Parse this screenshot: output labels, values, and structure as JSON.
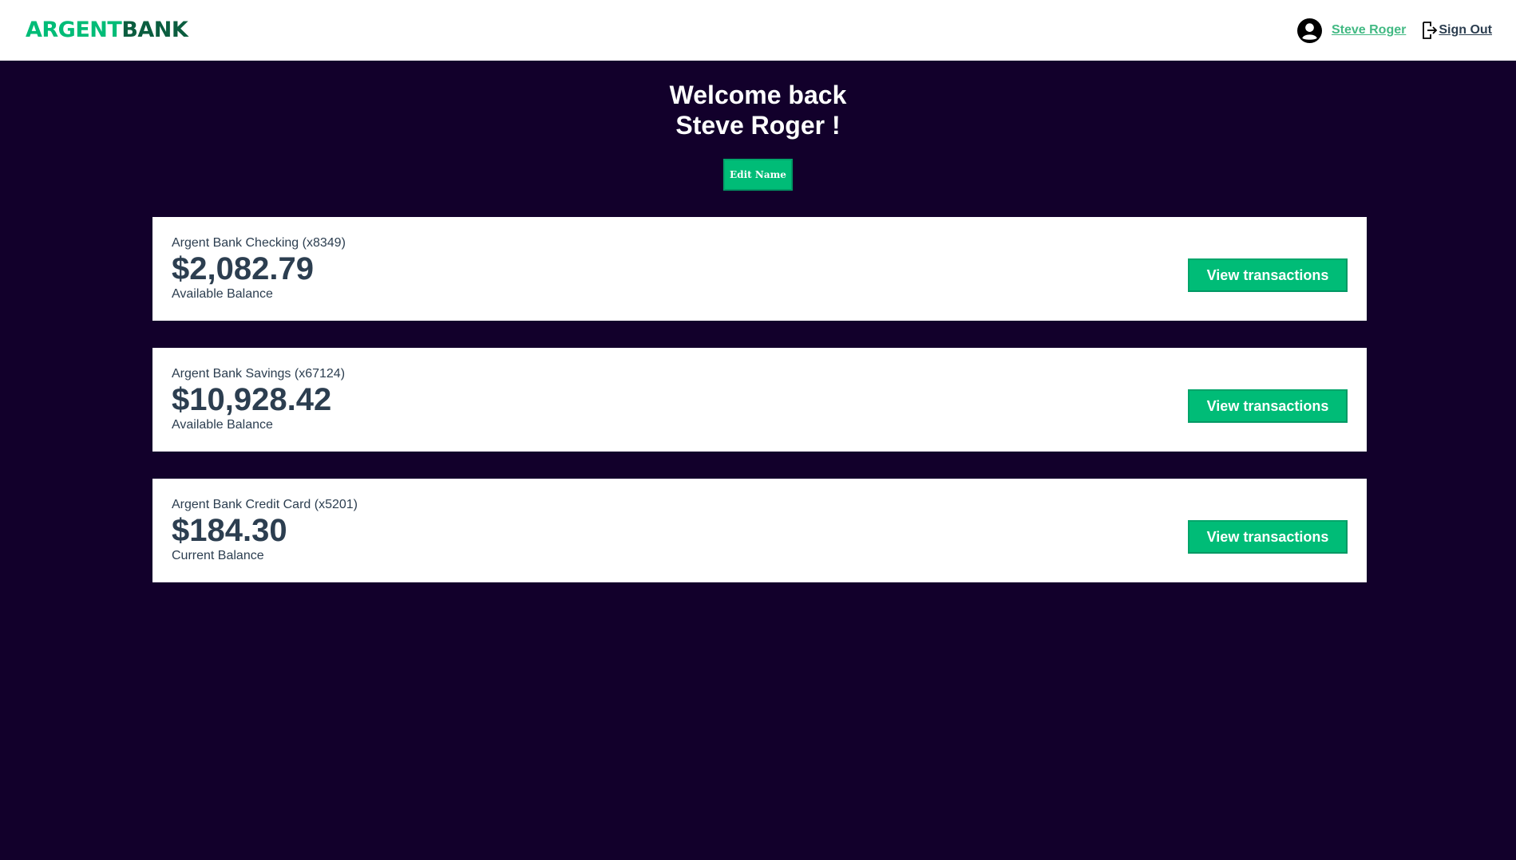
{
  "nav": {
    "logo_part1": "ARGENT",
    "logo_part2": "BANK",
    "user_name": "Steve Roger",
    "sign_out": "Sign Out"
  },
  "header": {
    "line1": "Welcome back",
    "line2": "Steve Roger !",
    "edit_button": "Edit Name"
  },
  "accounts": [
    {
      "title": "Argent Bank Checking (x8349)",
      "amount": "$2,082.79",
      "description": "Available Balance",
      "button": "View transactions"
    },
    {
      "title": "Argent Bank Savings (x67124)",
      "amount": "$10,928.42",
      "description": "Available Balance",
      "button": "View transactions"
    },
    {
      "title": "Argent Bank Credit Card (x5201)",
      "amount": "$184.30",
      "description": "Current Balance",
      "button": "View transactions"
    }
  ],
  "colors": {
    "background": "#12002b",
    "accent": "#00bc77",
    "logo_dark": "#0b5d3f",
    "text": "#2c3e50",
    "active_link": "#42b983"
  },
  "icons": {
    "avatar": "user-circle-icon",
    "sign_out": "sign-out-icon"
  }
}
